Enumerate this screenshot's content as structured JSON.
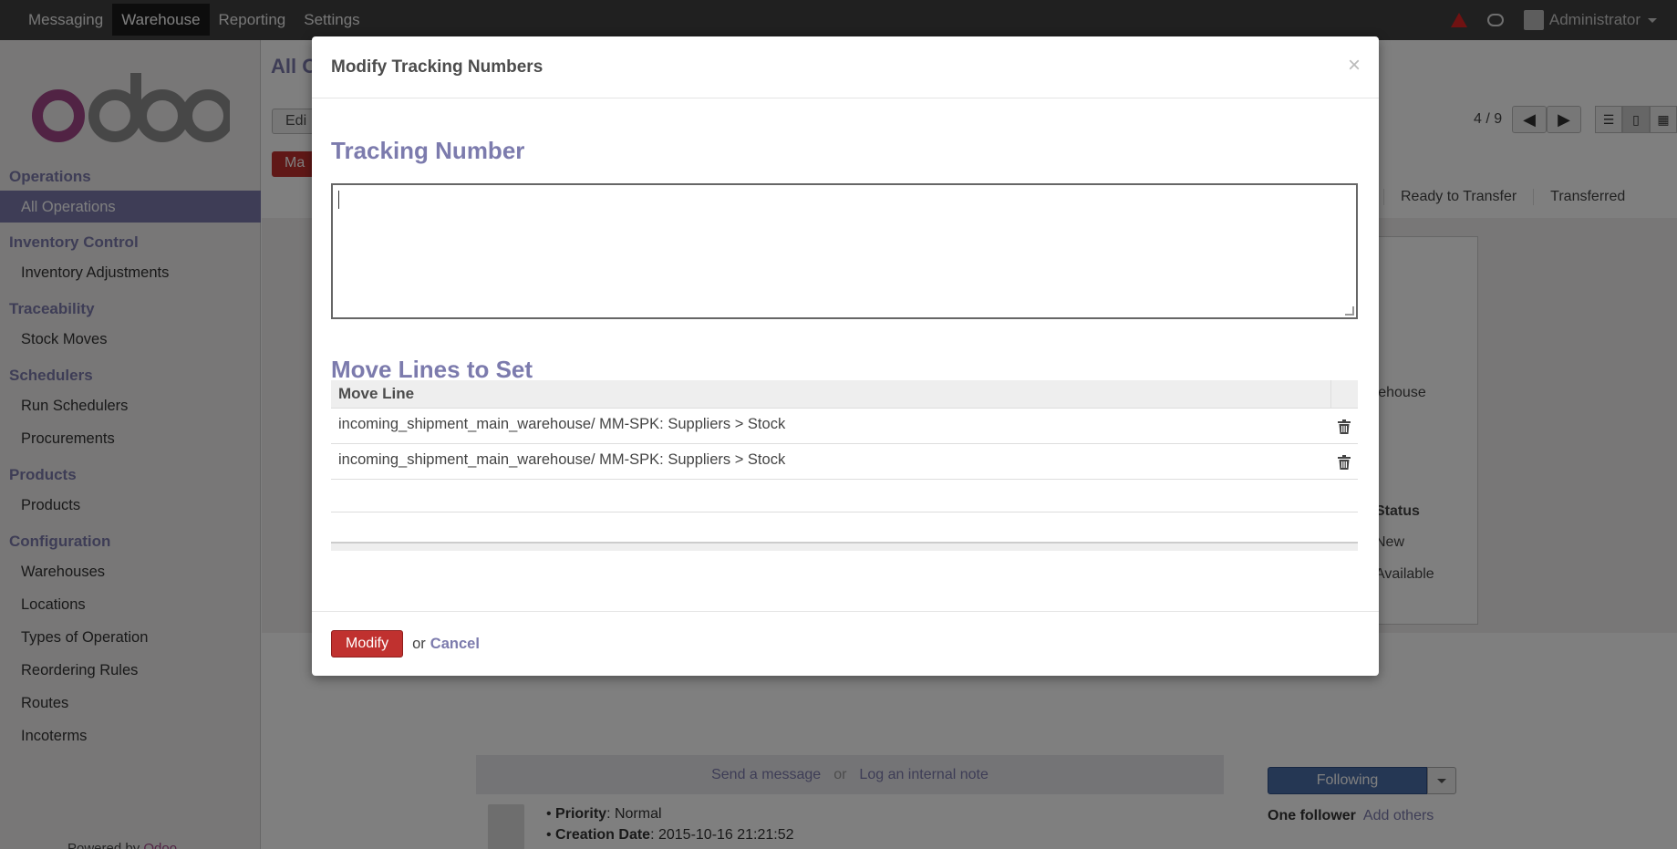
{
  "topnav": {
    "items": [
      "Messaging",
      "Warehouse",
      "Reporting",
      "Settings"
    ],
    "user_name": "Administrator"
  },
  "sidebar": {
    "sections": [
      {
        "title": "Operations",
        "items": [
          "All Operations"
        ]
      },
      {
        "title": "Inventory Control",
        "items": [
          "Inventory Adjustments"
        ]
      },
      {
        "title": "Traceability",
        "items": [
          "Stock Moves"
        ]
      },
      {
        "title": "Schedulers",
        "items": [
          "Run Schedulers",
          "Procurements"
        ]
      },
      {
        "title": "Products",
        "items": [
          "Products"
        ]
      },
      {
        "title": "Configuration",
        "items": [
          "Warehouses",
          "Locations",
          "Types of Operation",
          "Reordering Rules",
          "Routes",
          "Incoterms"
        ]
      }
    ],
    "powered_prefix": "Powered by ",
    "powered_brand": "Odoo"
  },
  "background": {
    "title_fragment": "All O",
    "edit_fragment": "Edi",
    "mark_fragment": "Ma",
    "pager": "4 / 9",
    "status_steps": [
      "Ready to Transfer",
      "Transferred"
    ],
    "warehouse_fragment": "arehouse",
    "table_header_status": "Status",
    "table_status_values": [
      "New",
      "Available"
    ],
    "send_message": "Send a message",
    "or": "or",
    "log_note": "Log an internal note",
    "following": "Following",
    "one_follower": "One follower",
    "add_others": "Add others",
    "priority_label": "Priority",
    "priority_value": ": Normal",
    "creation_label": "Creation Date",
    "creation_value": ": 2015-10-16 21:21:52"
  },
  "modal": {
    "title": "Modify Tracking Numbers",
    "close": "×",
    "tracking_heading": "Tracking Number",
    "tracking_value": "",
    "move_lines_heading": "Move Lines to Set",
    "table_header": "Move Line",
    "rows": [
      "incoming_shipment_main_warehouse/ MM-SPK: Suppliers > Stock",
      "incoming_shipment_main_warehouse/ MM-SPK: Suppliers > Stock"
    ],
    "modify_label": "Modify",
    "or_label": "or",
    "cancel_label": "Cancel"
  }
}
